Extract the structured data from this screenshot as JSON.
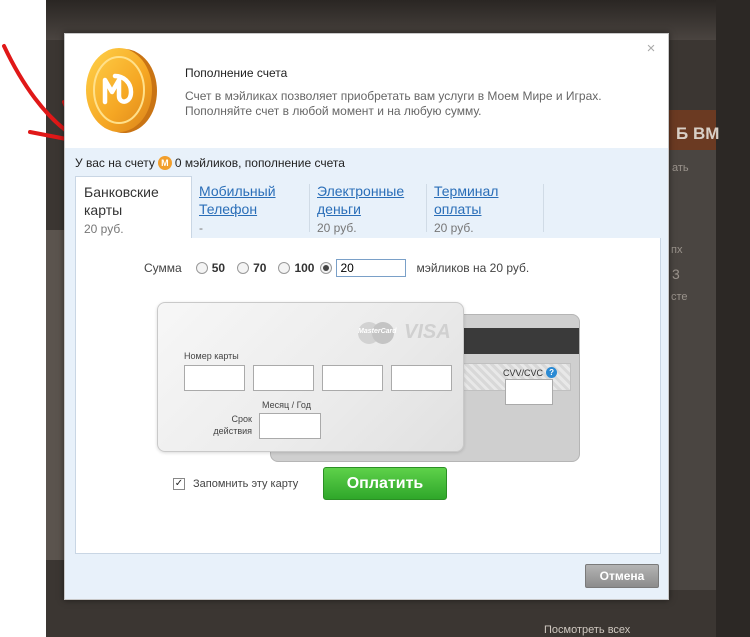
{
  "background": {
    "right_text_1": "Б ВМ",
    "right_text_2": "ать",
    "right_text_3": "пх",
    "right_text_4": "3",
    "right_text_5": "сте",
    "bottom_right": "Посмотреть всех"
  },
  "dialog": {
    "close_glyph": "×",
    "title": "Пополнение счета",
    "description": "Счет в мэйликах позволяет приобретать вам услуги в Моем Мире и Играх. Пополняйте счет в любой момент и на любую сумму.",
    "balance_prefix": "У вас на счету",
    "balance_icon_letter": "M",
    "balance_suffix": "0 мэйликов, пополнение счета"
  },
  "tabs": [
    {
      "line1": "Банковские",
      "line2": "карты",
      "sub": "20 руб."
    },
    {
      "line1": "Мобильный",
      "line2": "Телефон",
      "sub": "-"
    },
    {
      "line1": "Электронные",
      "line2": "деньги",
      "sub": "20 руб."
    },
    {
      "line1": "Терминал",
      "line2": "оплаты",
      "sub": "20 руб."
    }
  ],
  "sum": {
    "label": "Сумма",
    "options": [
      "50",
      "70",
      "100"
    ],
    "custom_value": "20",
    "suffix": "мэйликов на 20 руб."
  },
  "card": {
    "mastercard_label": "MasterCard",
    "visa_label": "VISA",
    "card_number_label": "Номер карты",
    "expiry_label": "Месяц / Год",
    "validity_label": "Срок действия",
    "cvv_label": "CVV/CVC",
    "help_glyph": "?"
  },
  "remember": {
    "label": "Запомнить эту карту",
    "checked": true
  },
  "buttons": {
    "pay": "Оплатить",
    "cancel": "Отмена"
  },
  "colors": {
    "pay_green": "#3cb834",
    "link_blue": "#2a6eb8",
    "body_blue": "#e8f1fa",
    "coin_orange": "#f29f2c"
  }
}
